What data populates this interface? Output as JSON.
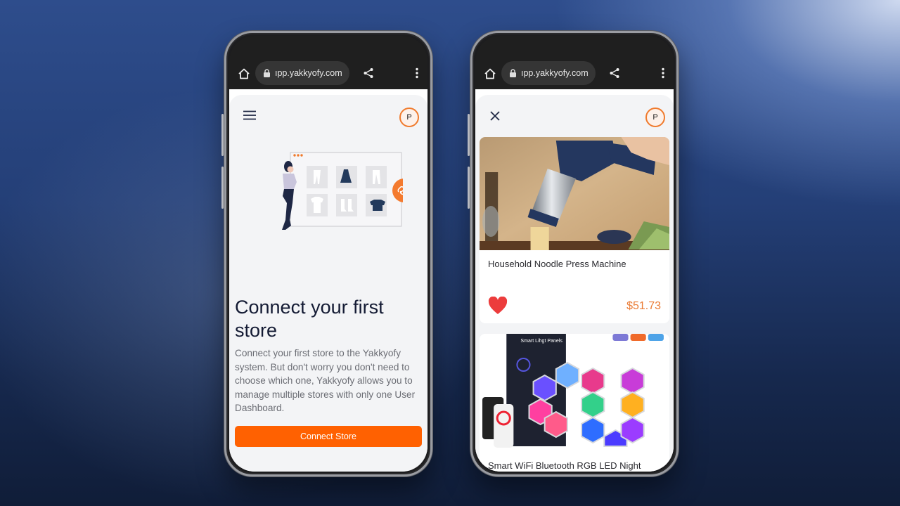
{
  "left_phone": {
    "browser": {
      "url": "ıpp.yakkyofy.com",
      "icons": [
        "home-icon",
        "lock-icon",
        "share-icon",
        "more-vert-icon"
      ]
    },
    "header": {
      "menu_icon": "hamburger-menu-icon",
      "avatar_initial": "P"
    },
    "illustration": "woman-with-store-products-and-link-icon",
    "title": "Connect your first store",
    "description": "Connect your first store to the Yakkyofy system. But don't worry you don't need to choose which one, Yakkyofy allows you to manage multiple stores with only one User Dashboard.",
    "button_label": "Connect Store",
    "accent_color": "#ff6101"
  },
  "right_phone": {
    "browser": {
      "url": "ıpp.yakkyofy.com",
      "icons": [
        "home-icon",
        "lock-icon",
        "share-icon",
        "more-vert-icon"
      ]
    },
    "header": {
      "close_icon": "close-icon",
      "avatar_initial": "P"
    },
    "products": [
      {
        "image": "noodle-press-machine-photo",
        "title": "Household Noodle Press Machine",
        "favorite": true,
        "price": "$51.73"
      },
      {
        "image": "hexagon-rgb-light-panels-photo",
        "title": "Smart WiFi Bluetooth RGB LED Night"
      }
    ],
    "price_color": "#ea7a33"
  }
}
